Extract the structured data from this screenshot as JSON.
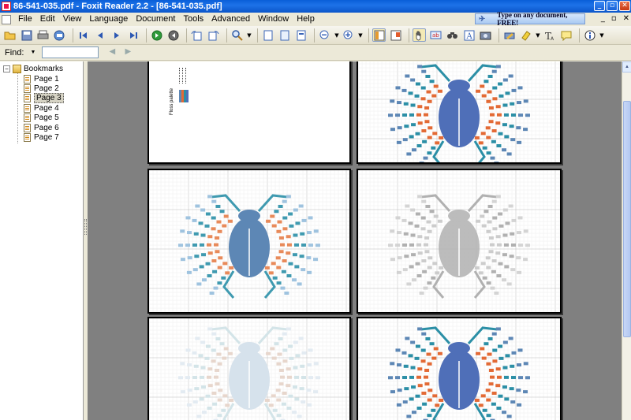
{
  "window": {
    "title": "86-541-035.pdf - Foxit Reader 2.2 - [86-541-035.pdf]",
    "buttons": [
      "_",
      "▫",
      "✕"
    ]
  },
  "menu": {
    "items": [
      "File",
      "Edit",
      "View",
      "Language",
      "Document",
      "Tools",
      "Advanced",
      "Window",
      "Help"
    ],
    "ad_text": "Type on any document, FREE!",
    "mdi_buttons": [
      "_",
      "▫",
      "✕"
    ]
  },
  "find": {
    "label": "Find:",
    "value": ""
  },
  "sidebar": {
    "root_label": "Bookmarks",
    "toggle": "−",
    "pages": [
      "Page 1",
      "Page 2",
      "Page 3",
      "Page 4",
      "Page 5",
      "Page 6",
      "Page 7"
    ],
    "selected_index": 2
  },
  "document": {
    "page1_heading": "Floss palette",
    "page1_rows": [
      "XXXXX",
      "XXXXX",
      "XXXXX",
      "XXXXX"
    ]
  },
  "colors": {
    "blue": "#4f6fb8",
    "orange": "#e36a35",
    "teal": "#2b8fa6",
    "lightblue": "#9fc3df",
    "steel": "#5d87b5"
  }
}
